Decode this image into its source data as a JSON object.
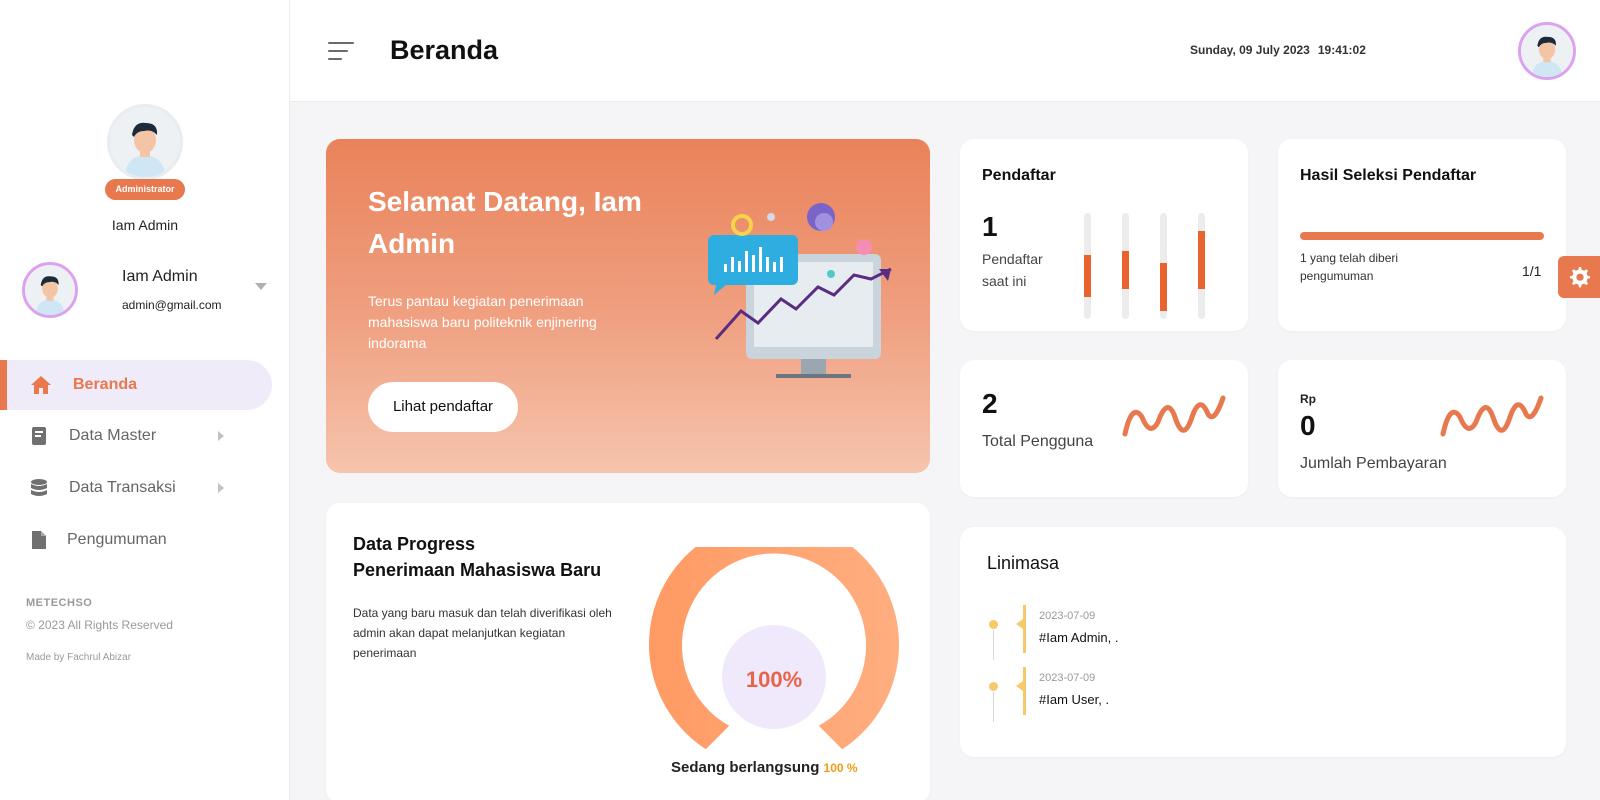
{
  "sidebar": {
    "role_badge": "Administrator",
    "top_name": "Iam Admin",
    "user": {
      "name": "Iam Admin",
      "email": "admin@gmail.com"
    },
    "nav": [
      {
        "label": "Beranda",
        "icon": "home-icon",
        "active": true
      },
      {
        "label": "Data Master",
        "icon": "book-icon"
      },
      {
        "label": "Data Transaksi",
        "icon": "database-icon"
      },
      {
        "label": "Pengumuman",
        "icon": "file-icon"
      }
    ],
    "footer": {
      "brand": "METECHSO",
      "copyright": "© 2023 All Rights Reserved",
      "made_by": "Made by Fachrul Abizar"
    }
  },
  "header": {
    "title": "Beranda",
    "date": "Sunday, 09 July 2023",
    "time": "19:41:02"
  },
  "welcome": {
    "title": "Selamat Datang, Iam Admin",
    "description": "Terus pantau kegiatan penerimaan mahasiswa baru politeknik enjinering indorama",
    "button": "Lihat pendaftar"
  },
  "progress": {
    "title_line1": "Data Progress",
    "title_line2": "Penerimaan Mahasiswa Baru",
    "description": "Data yang baru masuk dan telah diverifikasi oleh admin akan dapat melanjutkan kegiatan penerimaan",
    "percent": "100%",
    "percent_value": 100,
    "status_label": "Sedang berlangsung",
    "status_value": "100 %"
  },
  "pendaftar": {
    "title": "Pendaftar",
    "count": "1",
    "label": "Pendaftar saat ini"
  },
  "seleksi": {
    "title": "Hasil Seleksi Pendaftar",
    "progress": 1.0,
    "label": "1 yang telah diberi pengumuman",
    "ratio": "1/1"
  },
  "pengguna": {
    "count": "2",
    "label": "Total Pengguna"
  },
  "pembayaran": {
    "currency": "Rp",
    "amount": "0",
    "label": "Jumlah Pembayaran"
  },
  "linimasa": {
    "title": "Linimasa",
    "items": [
      {
        "date": "2023-07-09",
        "text": "#Iam Admin, ."
      },
      {
        "date": "2023-07-09",
        "text": "#Iam User, ."
      }
    ]
  },
  "colors": {
    "accent": "#e8784e",
    "timeline": "#f7c96a",
    "active_bg": "#f0ebf8"
  }
}
